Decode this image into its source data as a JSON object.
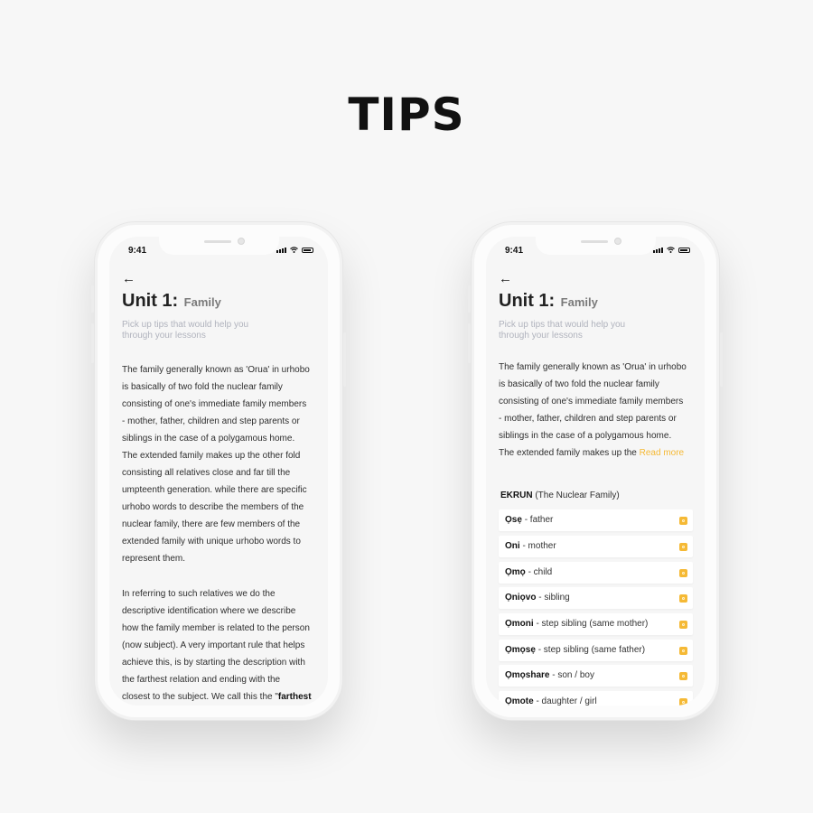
{
  "page_title": "TIPS",
  "status_time": "9:41",
  "back_glyph": "←",
  "unit_title": "Unit 1:",
  "unit_topic": "Family",
  "subtitle_lines": [
    "Pick up tips that would help you",
    "through your lessons"
  ],
  "left_screen": {
    "body_lines": [
      "The family generally known as 'Orua' in urhobo",
      "is basically of two fold the nuclear family",
      "consisting of one's immediate family members",
      "- mother, father, children and step parents or",
      "siblings in the case of a polygamous home.",
      "The extended family makes up the other fold",
      "consisting all relatives close and far till the",
      "umpteenth generation. while there are specific",
      "urhobo words to describe the members of the",
      "nuclear family, there are few members of the",
      "extended family with unique urhobo words to",
      "represent them."
    ],
    "body2_lines": [
      "In referring to such relatives we do the",
      "descriptive identification where we describe",
      "how the family member is related to the person",
      "(now subject). A very important rule that helps",
      "achieve this, is by starting the description with",
      "the farthest relation and ending with the"
    ],
    "last_line_text": "closest to the subject. We call this the \"",
    "last_line_bold": "farthest"
  },
  "right_screen": {
    "body_lines": [
      "The family generally known as 'Orua' in urhobo",
      "is basically of two fold the nuclear family",
      "consisting of one's immediate family members",
      "- mother, father, children and step parents or",
      "siblings in the case of a polygamous home."
    ],
    "last_line_text": "The extended family makes up the ",
    "read_more": "Read more",
    "section_word": "EKRUN",
    "section_gloss": "(The Nuclear Family)",
    "words": [
      {
        "term": "Ọsẹ",
        "meaning": "- father"
      },
      {
        "term": "Oni",
        "meaning": "- mother"
      },
      {
        "term": "Ọmọ",
        "meaning": "- child"
      },
      {
        "term": "Ọniọvo",
        "meaning": "- sibling"
      },
      {
        "term": "Ọmoni",
        "meaning": "- step sibling (same mother)"
      },
      {
        "term": "Ọmọsẹ",
        "meaning": "- step sibling (same father)"
      },
      {
        "term": "Ọmọshare",
        "meaning": "- son / boy"
      },
      {
        "term": "Ọmote",
        "meaning": "- daughter / girl"
      }
    ]
  },
  "colors": {
    "accent": "#f5b935",
    "subtitle": "#b0b3bd",
    "background": "#f7f7f7"
  },
  "icons": [
    "back-arrow-icon",
    "signal-icon",
    "wifi-icon",
    "battery-icon",
    "audio-icon"
  ]
}
